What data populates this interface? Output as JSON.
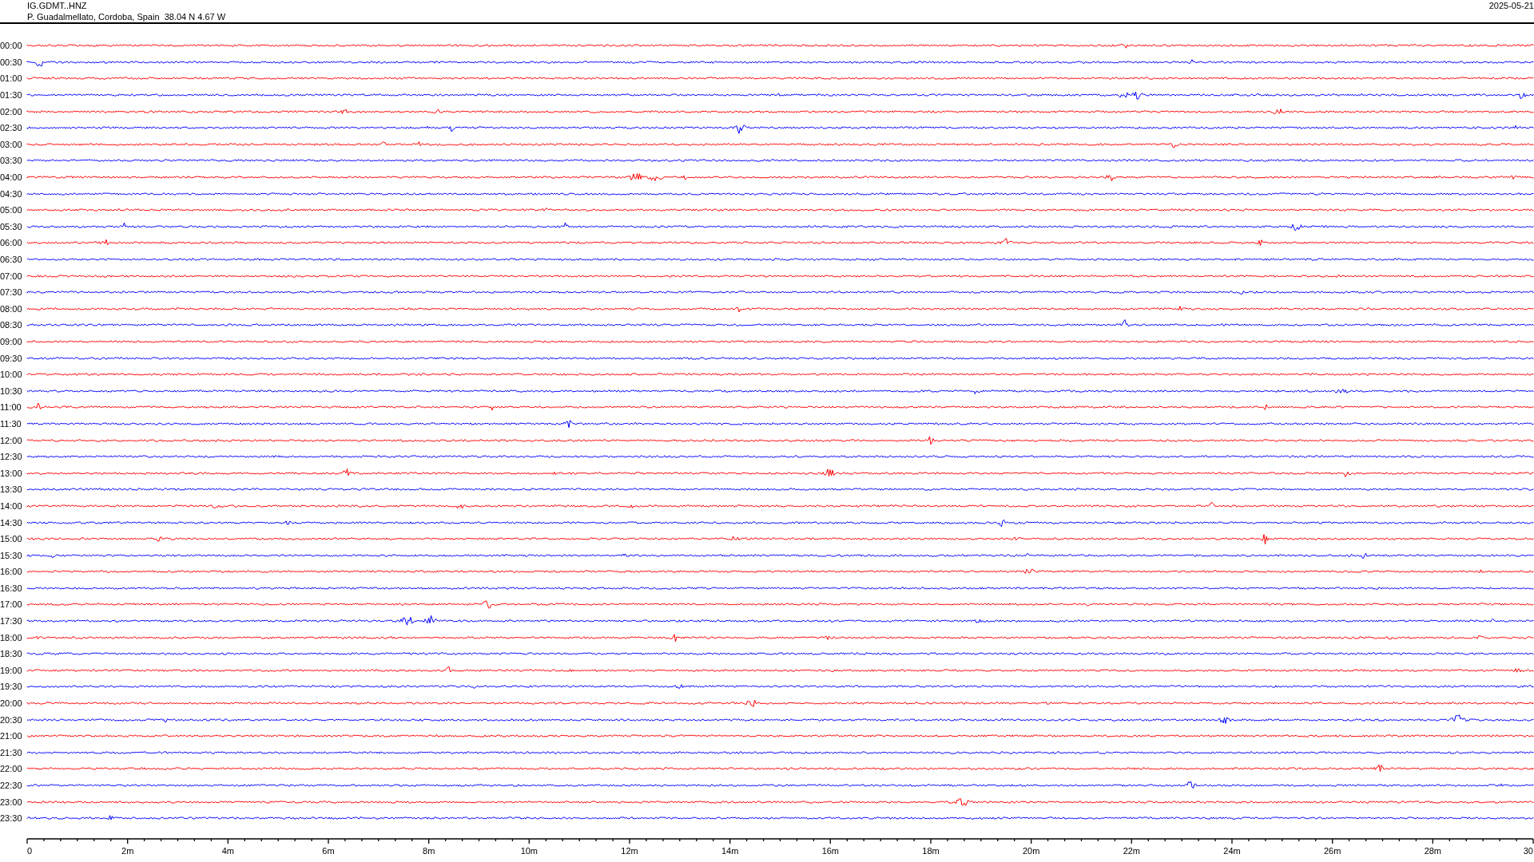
{
  "header": {
    "station": "IG.GDMT..HNZ",
    "location": "P. Guadalmellato, Cordoba, Spain  38.04 N 4.67 W",
    "date": "2025-05-21"
  },
  "traces": [
    {
      "label": "00:00",
      "color": "#ff0000"
    },
    {
      "label": "00:30",
      "color": "#0000ff"
    },
    {
      "label": "01:00",
      "color": "#ff0000"
    },
    {
      "label": "01:30",
      "color": "#0000ff"
    },
    {
      "label": "02:00",
      "color": "#ff0000"
    },
    {
      "label": "02:30",
      "color": "#0000ff"
    },
    {
      "label": "03:00",
      "color": "#ff0000"
    },
    {
      "label": "03:30",
      "color": "#0000ff"
    },
    {
      "label": "04:00",
      "color": "#ff0000"
    },
    {
      "label": "04:30",
      "color": "#0000ff"
    },
    {
      "label": "05:00",
      "color": "#ff0000"
    },
    {
      "label": "05:30",
      "color": "#0000ff"
    },
    {
      "label": "06:00",
      "color": "#ff0000"
    },
    {
      "label": "06:30",
      "color": "#0000ff"
    },
    {
      "label": "07:00",
      "color": "#ff0000"
    },
    {
      "label": "07:30",
      "color": "#0000ff"
    },
    {
      "label": "08:00",
      "color": "#ff0000"
    },
    {
      "label": "08:30",
      "color": "#0000ff"
    },
    {
      "label": "09:00",
      "color": "#ff0000"
    },
    {
      "label": "09:30",
      "color": "#0000ff"
    },
    {
      "label": "10:00",
      "color": "#ff0000"
    },
    {
      "label": "10:30",
      "color": "#0000ff"
    },
    {
      "label": "11:00",
      "color": "#ff0000"
    },
    {
      "label": "11:30",
      "color": "#0000ff"
    },
    {
      "label": "12:00",
      "color": "#ff0000"
    },
    {
      "label": "12:30",
      "color": "#0000ff"
    },
    {
      "label": "13:00",
      "color": "#ff0000"
    },
    {
      "label": "13:30",
      "color": "#0000ff"
    },
    {
      "label": "14:00",
      "color": "#ff0000"
    },
    {
      "label": "14:30",
      "color": "#0000ff"
    },
    {
      "label": "15:00",
      "color": "#ff0000"
    },
    {
      "label": "15:30",
      "color": "#0000ff"
    },
    {
      "label": "16:00",
      "color": "#ff0000"
    },
    {
      "label": "16:30",
      "color": "#0000ff"
    },
    {
      "label": "17:00",
      "color": "#ff0000"
    },
    {
      "label": "17:30",
      "color": "#0000ff"
    },
    {
      "label": "18:00",
      "color": "#ff0000"
    },
    {
      "label": "18:30",
      "color": "#0000ff"
    },
    {
      "label": "19:00",
      "color": "#ff0000"
    },
    {
      "label": "19:30",
      "color": "#0000ff"
    },
    {
      "label": "20:00",
      "color": "#ff0000"
    },
    {
      "label": "20:30",
      "color": "#0000ff"
    },
    {
      "label": "21:00",
      "color": "#ff0000"
    },
    {
      "label": "21:30",
      "color": "#0000ff"
    },
    {
      "label": "22:00",
      "color": "#ff0000"
    },
    {
      "label": "22:30",
      "color": "#0000ff"
    },
    {
      "label": "23:00",
      "color": "#ff0000"
    },
    {
      "label": "23:30",
      "color": "#0000ff"
    }
  ],
  "time_axis": {
    "ticks": [
      "0",
      "2m",
      "4m",
      "6m",
      "8m",
      "10m",
      "12m",
      "14m",
      "16m",
      "18m",
      "20m",
      "22m",
      "24m",
      "26m",
      "28m",
      "30"
    ]
  }
}
